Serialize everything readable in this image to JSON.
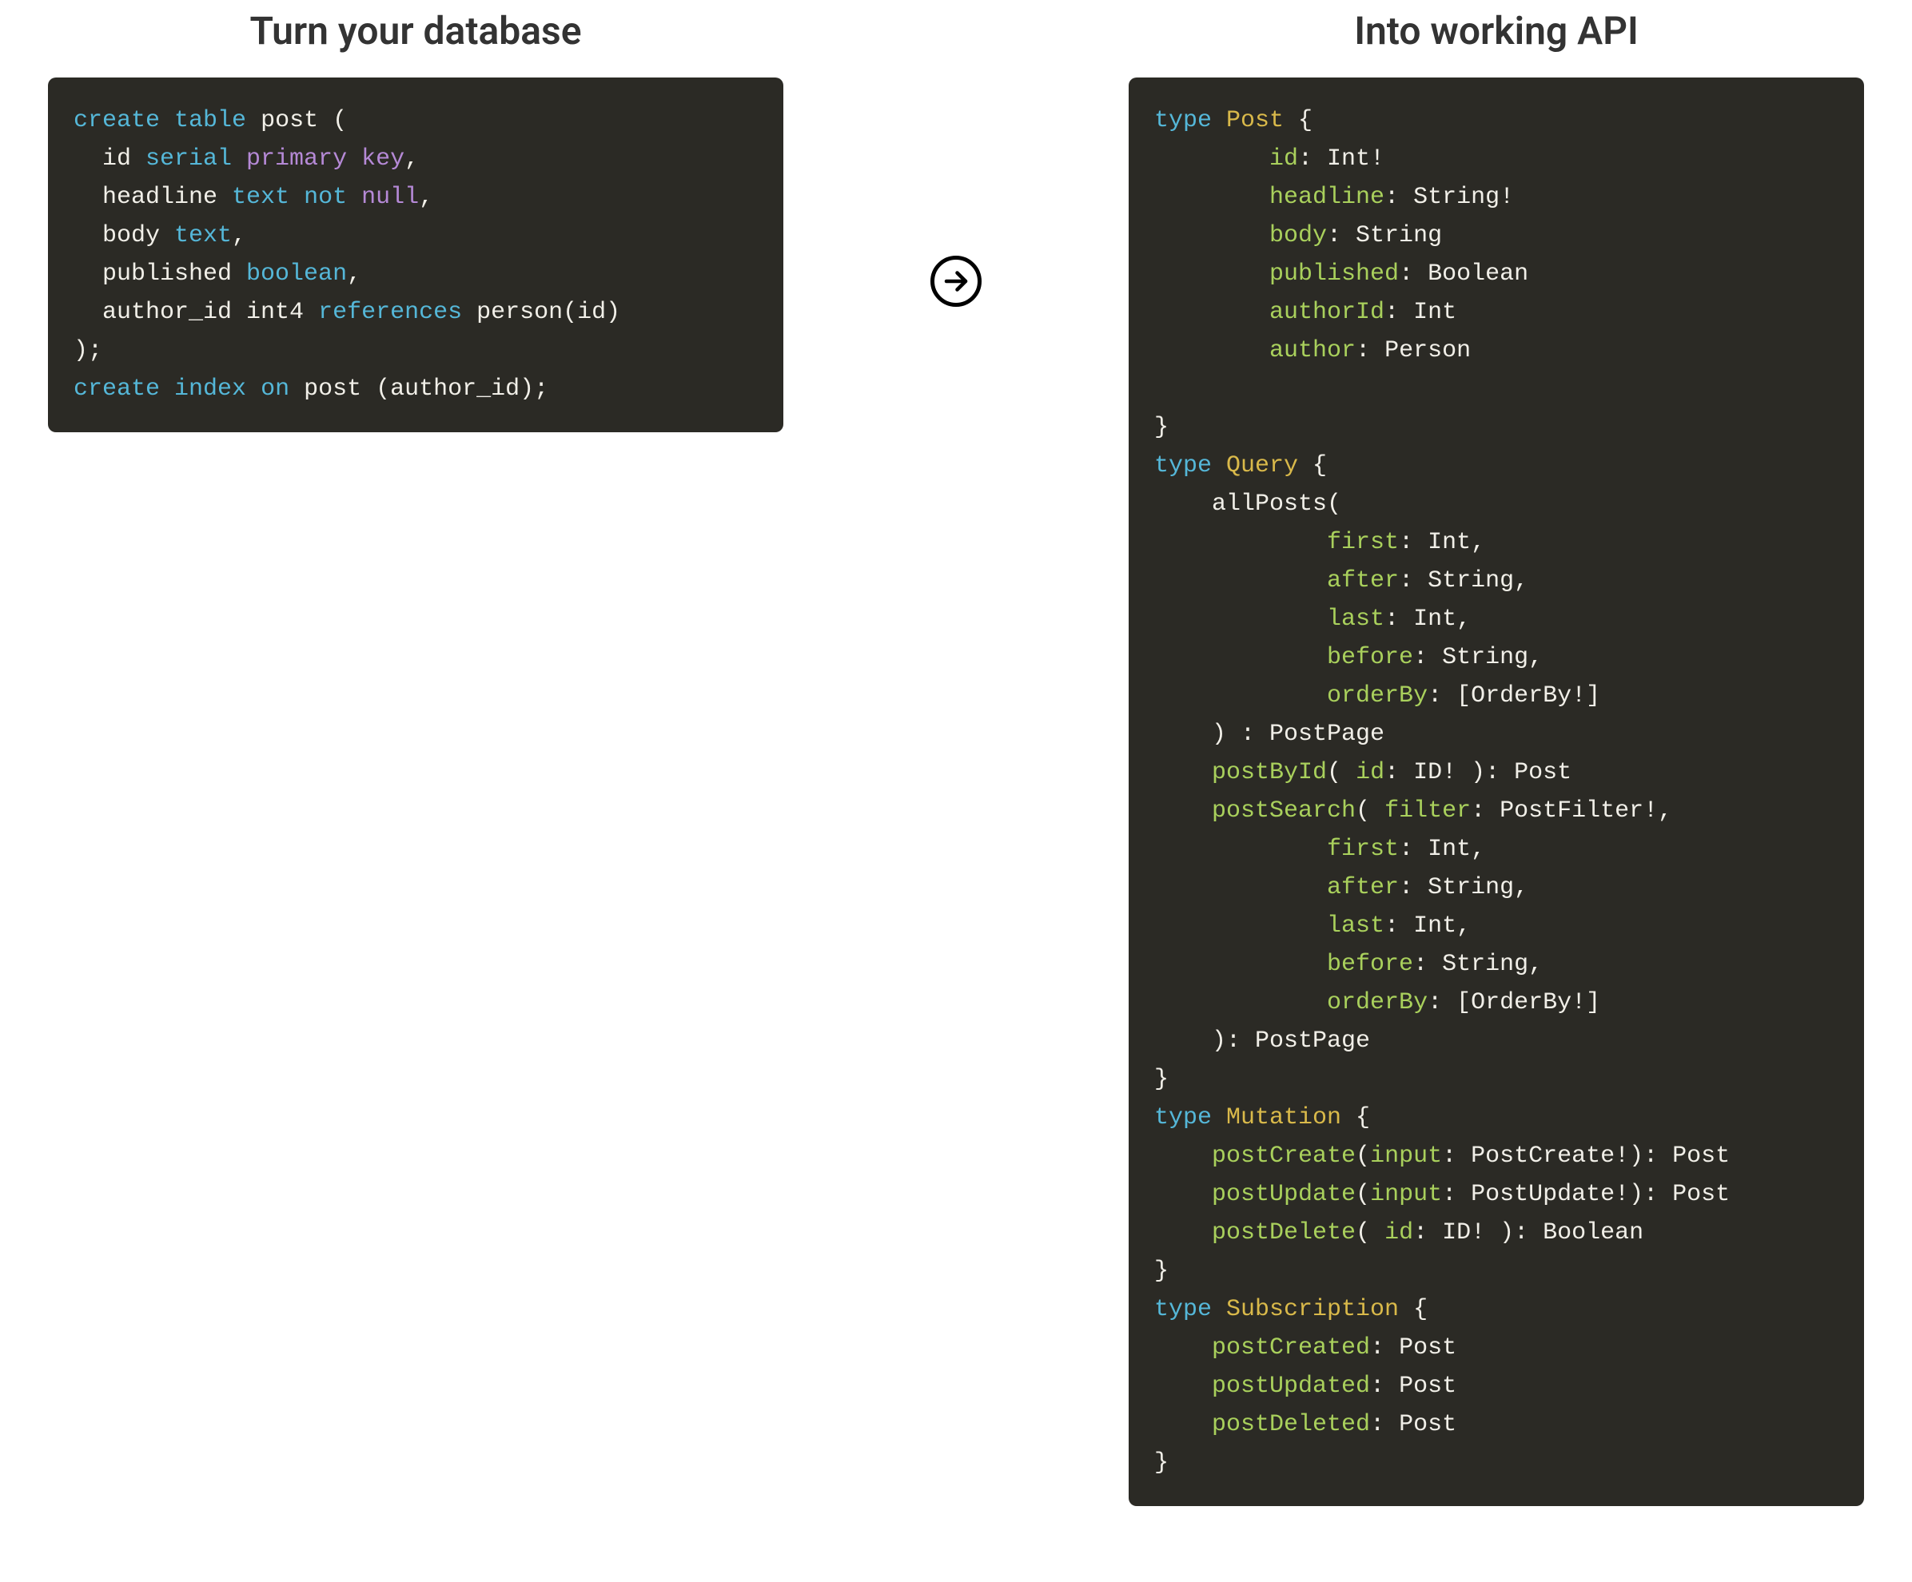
{
  "left": {
    "title": "Turn your database",
    "code": [
      [
        [
          "kw",
          "create "
        ],
        [
          "kw",
          "table "
        ],
        [
          "str",
          "post ("
        ]
      ],
      [
        [
          "str",
          "  id "
        ],
        [
          "ty",
          "serial "
        ],
        [
          "kw2",
          "primary "
        ],
        [
          "kw2",
          "key"
        ],
        [
          "str",
          ","
        ]
      ],
      [
        [
          "str",
          "  headline "
        ],
        [
          "ty",
          "text "
        ],
        [
          "ty",
          "not "
        ],
        [
          "kw2",
          "null"
        ],
        [
          "str",
          ","
        ]
      ],
      [
        [
          "str",
          "  body "
        ],
        [
          "ty",
          "text"
        ],
        [
          "str",
          ","
        ]
      ],
      [
        [
          "str",
          "  published "
        ],
        [
          "ty",
          "boolean"
        ],
        [
          "str",
          ","
        ]
      ],
      [
        [
          "str",
          "  author_id int4 "
        ],
        [
          "ty",
          "references "
        ],
        [
          "str",
          "person(id)"
        ]
      ],
      [
        [
          "str",
          ");"
        ]
      ],
      [
        [
          "kw",
          "create "
        ],
        [
          "kw",
          "index "
        ],
        [
          "kw",
          "on "
        ],
        [
          "str",
          "post (author_id);"
        ]
      ]
    ]
  },
  "right": {
    "title": "Into working API",
    "code": [
      [
        [
          "kw",
          "type "
        ],
        [
          "yel",
          "Post "
        ],
        [
          "str",
          "{"
        ]
      ],
      [
        [
          "str",
          "        "
        ],
        [
          "fn",
          "id"
        ],
        [
          "str",
          ": Int!"
        ]
      ],
      [
        [
          "str",
          "        "
        ],
        [
          "fn",
          "headline"
        ],
        [
          "str",
          ": String!"
        ]
      ],
      [
        [
          "str",
          "        "
        ],
        [
          "fn",
          "body"
        ],
        [
          "str",
          ": String"
        ]
      ],
      [
        [
          "str",
          "        "
        ],
        [
          "fn",
          "published"
        ],
        [
          "str",
          ": Boolean"
        ]
      ],
      [
        [
          "str",
          "        "
        ],
        [
          "fn",
          "authorId"
        ],
        [
          "str",
          ": Int"
        ]
      ],
      [
        [
          "str",
          "        "
        ],
        [
          "fn",
          "author"
        ],
        [
          "str",
          ": Person"
        ]
      ],
      [
        [
          "str",
          ""
        ]
      ],
      [
        [
          "str",
          "}"
        ]
      ],
      [
        [
          "kw",
          "type "
        ],
        [
          "yel",
          "Query "
        ],
        [
          "str",
          "{"
        ]
      ],
      [
        [
          "str",
          "    allPosts("
        ]
      ],
      [
        [
          "str",
          "            "
        ],
        [
          "fn",
          "first"
        ],
        [
          "str",
          ": Int,"
        ]
      ],
      [
        [
          "str",
          "            "
        ],
        [
          "fn",
          "after"
        ],
        [
          "str",
          ": String,"
        ]
      ],
      [
        [
          "str",
          "            "
        ],
        [
          "fn",
          "last"
        ],
        [
          "str",
          ": Int,"
        ]
      ],
      [
        [
          "str",
          "            "
        ],
        [
          "fn",
          "before"
        ],
        [
          "str",
          ": String,"
        ]
      ],
      [
        [
          "str",
          "            "
        ],
        [
          "fn",
          "orderBy"
        ],
        [
          "str",
          ": [OrderBy!]"
        ]
      ],
      [
        [
          "str",
          "    ) : PostPage"
        ]
      ],
      [
        [
          "str",
          "    "
        ],
        [
          "fn",
          "postById"
        ],
        [
          "str",
          "( "
        ],
        [
          "fn",
          "id"
        ],
        [
          "str",
          ": ID! ): Post"
        ]
      ],
      [
        [
          "str",
          "    "
        ],
        [
          "fn",
          "postSearch"
        ],
        [
          "str",
          "( "
        ],
        [
          "fn",
          "filter"
        ],
        [
          "str",
          ": PostFilter!,"
        ]
      ],
      [
        [
          "str",
          "            "
        ],
        [
          "fn",
          "first"
        ],
        [
          "str",
          ": Int,"
        ]
      ],
      [
        [
          "str",
          "            "
        ],
        [
          "fn",
          "after"
        ],
        [
          "str",
          ": String,"
        ]
      ],
      [
        [
          "str",
          "            "
        ],
        [
          "fn",
          "last"
        ],
        [
          "str",
          ": Int,"
        ]
      ],
      [
        [
          "str",
          "            "
        ],
        [
          "fn",
          "before"
        ],
        [
          "str",
          ": String,"
        ]
      ],
      [
        [
          "str",
          "            "
        ],
        [
          "fn",
          "orderBy"
        ],
        [
          "str",
          ": [OrderBy!]"
        ]
      ],
      [
        [
          "str",
          "    ): PostPage"
        ]
      ],
      [
        [
          "str",
          "}"
        ]
      ],
      [
        [
          "kw",
          "type "
        ],
        [
          "yel",
          "Mutation "
        ],
        [
          "str",
          "{"
        ]
      ],
      [
        [
          "str",
          "    "
        ],
        [
          "fn",
          "postCreate"
        ],
        [
          "str",
          "("
        ],
        [
          "fn",
          "input"
        ],
        [
          "str",
          ": PostCreate!): Post"
        ]
      ],
      [
        [
          "str",
          "    "
        ],
        [
          "fn",
          "postUpdate"
        ],
        [
          "str",
          "("
        ],
        [
          "fn",
          "input"
        ],
        [
          "str",
          ": PostUpdate!): Post"
        ]
      ],
      [
        [
          "str",
          "    "
        ],
        [
          "fn",
          "postDelete"
        ],
        [
          "str",
          "( "
        ],
        [
          "fn",
          "id"
        ],
        [
          "str",
          ": ID! ): Boolean"
        ]
      ],
      [
        [
          "str",
          "}"
        ]
      ],
      [
        [
          "kw",
          "type "
        ],
        [
          "yel",
          "Subscription "
        ],
        [
          "str",
          "{"
        ]
      ],
      [
        [
          "str",
          "    "
        ],
        [
          "fn",
          "postCreated"
        ],
        [
          "str",
          ": Post"
        ]
      ],
      [
        [
          "str",
          "    "
        ],
        [
          "fn",
          "postUpdated"
        ],
        [
          "str",
          ": Post"
        ]
      ],
      [
        [
          "str",
          "    "
        ],
        [
          "fn",
          "postDeleted"
        ],
        [
          "str",
          ": Post"
        ]
      ],
      [
        [
          "str",
          "}"
        ]
      ]
    ]
  },
  "arrow": {
    "name": "arrow-right-icon"
  }
}
